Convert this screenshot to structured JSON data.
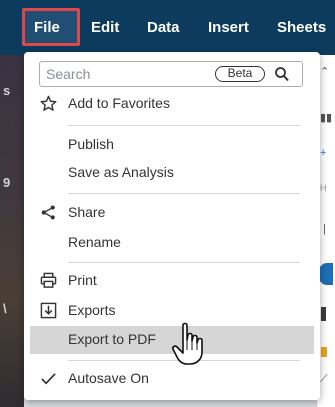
{
  "menubar": {
    "items": [
      {
        "label": "File",
        "active": true
      },
      {
        "label": "Edit"
      },
      {
        "label": "Data"
      },
      {
        "label": "Insert"
      },
      {
        "label": "Sheets"
      }
    ]
  },
  "dropdown": {
    "search": {
      "placeholder": "Search",
      "badge": "Beta"
    },
    "items": [
      {
        "label": "Add to Favorites",
        "icon": "star-icon"
      },
      {
        "label": "Publish"
      },
      {
        "label": "Save as Analysis"
      },
      {
        "label": "Share",
        "icon": "share-icon"
      },
      {
        "label": "Rename"
      },
      {
        "label": "Print",
        "icon": "print-icon"
      },
      {
        "label": "Exports",
        "icon": "export-icon"
      },
      {
        "label": "Export to PDF",
        "highlighted": true
      },
      {
        "label": "Autosave On",
        "icon": "check-icon"
      }
    ]
  },
  "colors": {
    "menubar_bg": "#0c3b5e",
    "highlight_border": "#e04848",
    "hover_bg": "#d6d6d6"
  }
}
